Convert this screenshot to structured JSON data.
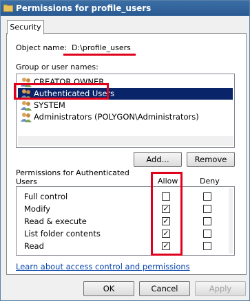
{
  "window": {
    "title": "Permissions for profile_users"
  },
  "tabs": [
    {
      "label": "Security"
    }
  ],
  "object": {
    "label": "Object name:",
    "value": "D:\\profile_users"
  },
  "group": {
    "label": "Group or user names:"
  },
  "users": [
    {
      "label": "CREATOR OWNER",
      "selected": false
    },
    {
      "label": "Authenticated Users",
      "selected": true
    },
    {
      "label": "SYSTEM",
      "selected": false
    },
    {
      "label": "Administrators (POLYGON\\Administrators)",
      "selected": false
    }
  ],
  "buttons": {
    "add": "Add...",
    "remove": "Remove",
    "ok": "OK",
    "cancel": "Cancel",
    "apply": "Apply"
  },
  "permissions": {
    "header": "Permissions for Authenticated Users",
    "allow_label": "Allow",
    "deny_label": "Deny",
    "rows": [
      {
        "name": "Full control",
        "allow": false,
        "deny": false
      },
      {
        "name": "Modify",
        "allow": true,
        "deny": false
      },
      {
        "name": "Read & execute",
        "allow": true,
        "deny": false
      },
      {
        "name": "List folder contents",
        "allow": true,
        "deny": false
      },
      {
        "name": "Read",
        "allow": true,
        "deny": false
      }
    ]
  },
  "link": {
    "label": "Learn about access control and permissions"
  },
  "colors": {
    "annotation": "#e0001b",
    "selection": "#0a246a",
    "link": "#0645ad"
  }
}
